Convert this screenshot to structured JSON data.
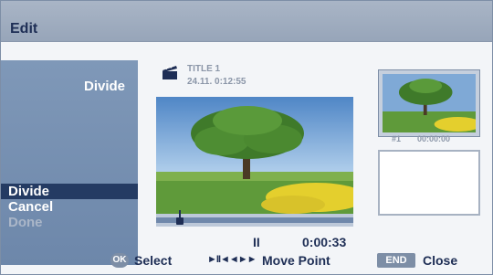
{
  "header": {
    "title": "Edit"
  },
  "left_panel": {
    "mode_label": "Divide",
    "menu": [
      {
        "label": "Divide",
        "state": "selected"
      },
      {
        "label": "Cancel",
        "state": "normal"
      },
      {
        "label": "Done",
        "state": "disabled"
      }
    ]
  },
  "title_info": {
    "icon": "clapperboard-icon",
    "name": "TITLE 1",
    "date_time": "24.11.  0:12:55"
  },
  "playback": {
    "state_symbol": "II",
    "time": "0:00:33"
  },
  "thumbnails": {
    "first": {
      "number": "#1",
      "time": "00:00:00"
    }
  },
  "footer": {
    "ok_icon": "OK",
    "select_label": "Select",
    "transport_icons": "►II◄◄►►",
    "move_label": "Move Point",
    "end_icon": "END",
    "close_label": "Close"
  },
  "colors": {
    "header": "#a9b5c6",
    "panel": "#7f98b8",
    "selected": "#243b63",
    "text_dark": "#1e2e55"
  }
}
